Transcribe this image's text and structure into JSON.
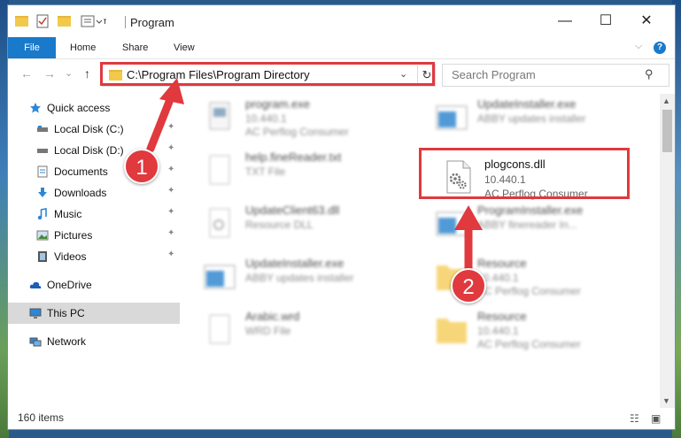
{
  "titlebar": {
    "title": "Program",
    "minimize": "—",
    "maximize": "☐",
    "close": "✕"
  },
  "ribbon": {
    "file": "File",
    "tabs": [
      "Home",
      "Share",
      "View"
    ],
    "expand": "⌵",
    "help": "?"
  },
  "nav": {
    "back": "←",
    "forward": "→",
    "recent": "⌄",
    "up": "↑",
    "address": "C:\\Program Files\\Program Directory",
    "address_chevron": "⌄",
    "refresh": "↻",
    "search_placeholder": "Search Program",
    "search_icon_glyph": "⚲"
  },
  "sidebar": {
    "items": [
      {
        "label": "Quick access",
        "icon": "star-icon"
      },
      {
        "label": "Local Disk (C:)",
        "icon": "drive-icon"
      },
      {
        "label": "Local Disk (D:)",
        "icon": "drive-icon"
      },
      {
        "label": "Documents",
        "icon": "documents-icon"
      },
      {
        "label": "Downloads",
        "icon": "download-icon"
      },
      {
        "label": "Music",
        "icon": "music-icon"
      },
      {
        "label": "Pictures",
        "icon": "pictures-icon"
      },
      {
        "label": "Videos",
        "icon": "videos-icon"
      },
      {
        "label": "OneDrive",
        "icon": "cloud-icon"
      },
      {
        "label": "This PC",
        "icon": "monitor-icon"
      },
      {
        "label": "Network",
        "icon": "network-icon"
      }
    ],
    "pin_glyph": "📌"
  },
  "files": [
    {
      "name": "program.exe",
      "sub1": "10.440.1",
      "sub2": "AC Perflog Consumer",
      "icon": "exe-icon"
    },
    {
      "name": "UpdateInstaller.exe",
      "sub1": "ABBY updates installer",
      "sub2": "",
      "icon": "window-icon"
    },
    {
      "name": "help.fineReader.txt",
      "sub1": "TXT File",
      "sub2": "",
      "icon": "text-file-icon"
    },
    {
      "name": "plogcons.dll",
      "sub1": "10.440.1",
      "sub2": "AC Perflog Consumer",
      "icon": "dll-gear-icon"
    },
    {
      "name": "UpdateClient63.dll",
      "sub1": "Resource DLL",
      "sub2": "",
      "icon": "dll-icon"
    },
    {
      "name": "ProgramInstaller.exe",
      "sub1": "ABBY finereader In...",
      "sub2": "",
      "icon": "window-icon"
    },
    {
      "name": "UpdateInstaller.exe",
      "sub1": "ABBY updates installer",
      "sub2": "",
      "icon": "window-icon"
    },
    {
      "name": "Resource",
      "sub1": "10.440.1",
      "sub2": "AC Perflog Consumer",
      "icon": "folder-icon"
    },
    {
      "name": "Arabic.wrd",
      "sub1": "WRD File",
      "sub2": "",
      "icon": "text-file-icon"
    },
    {
      "name": "Resource",
      "sub1": "10.440.1",
      "sub2": "AC Perflog Consumer",
      "icon": "folder-icon"
    }
  ],
  "status": {
    "count": "160 items"
  },
  "annotations": {
    "step1": "1",
    "step2": "2"
  },
  "colors": {
    "accent": "#1979ca",
    "highlight": "#e0393e",
    "folder": "#f3c94c"
  }
}
